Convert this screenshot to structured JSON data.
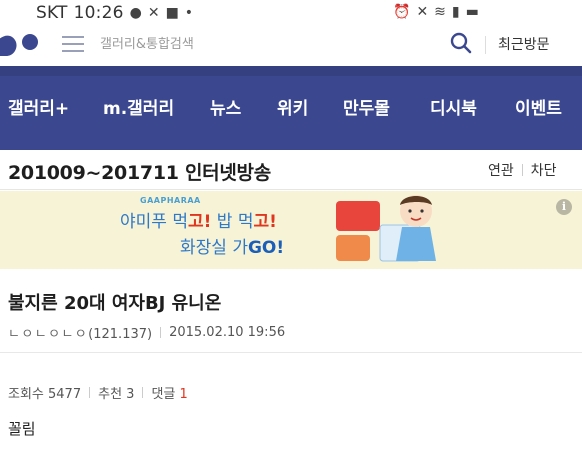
{
  "status_bar": {
    "carrier": "SKT",
    "time": "10:26"
  },
  "header": {
    "search_placeholder": "갤러리&통합검색",
    "recent_label": "최근방문"
  },
  "nav": {
    "items": [
      "갤러리+",
      "m.갤러리",
      "뉴스",
      "위키",
      "만두몰",
      "디시북",
      "이벤트"
    ]
  },
  "gallery": {
    "title": "201009~201711 인터넷방송",
    "related_label": "연관",
    "block_label": "차단"
  },
  "ad": {
    "brand": "GAAPHARAA",
    "line1_a": "야미푸 먹",
    "line1_b": "고!",
    "line1_c": " 밥 먹",
    "line1_d": "고!",
    "line2_a": "화장실 가",
    "line2_b": "GO!",
    "info_icon": "i"
  },
  "post": {
    "title": "불지른 20대 여자BJ 유니온",
    "author_nick": "ㄴㅇㄴㅇㄴㅇ",
    "author_ip": "(121.137)",
    "date": "2015.02.10 19:56",
    "views_label": "조회수 5477",
    "recommend_label": "추천 3",
    "comments_label": "댓글",
    "comments_count": "1",
    "body": "꼴림"
  },
  "colors": {
    "nav_bg": "#3b4890",
    "ad_bg": "#f7f3d6",
    "accent_red": "#e0361f",
    "ad_blue": "#2d78c8"
  }
}
